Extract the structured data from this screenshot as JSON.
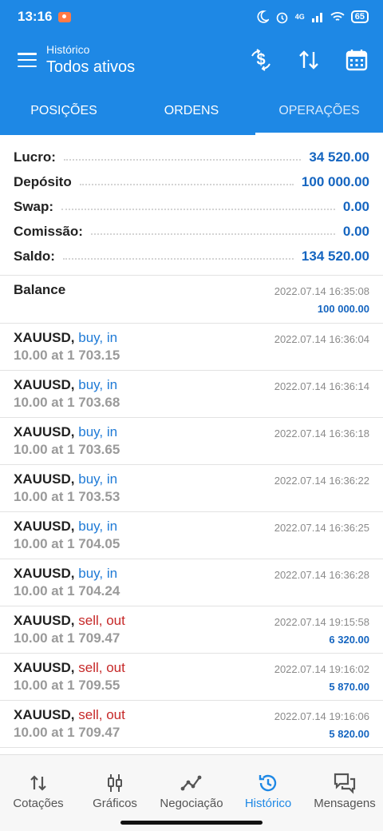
{
  "status_bar": {
    "time": "13:16",
    "battery": "65",
    "network": "4G"
  },
  "header": {
    "subtitle": "Histórico",
    "title": "Todos ativos"
  },
  "tabs": [
    {
      "label": "POSIÇÕES"
    },
    {
      "label": "ORDENS"
    },
    {
      "label": "OPERAÇÕES"
    }
  ],
  "summary": {
    "profit_label": "Lucro:",
    "profit_value": "34 520.00",
    "deposit_label": "Depósito",
    "deposit_value": "100 000.00",
    "swap_label": "Swap:",
    "swap_value": "0.00",
    "commission_label": "Comissão:",
    "commission_value": "0.00",
    "balance_label": "Saldo:",
    "balance_value": "134 520.00"
  },
  "balance_entry": {
    "label": "Balance",
    "time": "2022.07.14 16:35:08",
    "amount": "100 000.00"
  },
  "deals": [
    {
      "symbol": "XAUUSD,",
      "direction": "buy, in",
      "detail": "10.00 at 1 703.15",
      "time": "2022.07.14 16:36:04",
      "profit": ""
    },
    {
      "symbol": "XAUUSD,",
      "direction": "buy, in",
      "detail": "10.00 at 1 703.68",
      "time": "2022.07.14 16:36:14",
      "profit": ""
    },
    {
      "symbol": "XAUUSD,",
      "direction": "buy, in",
      "detail": "10.00 at 1 703.65",
      "time": "2022.07.14 16:36:18",
      "profit": ""
    },
    {
      "symbol": "XAUUSD,",
      "direction": "buy, in",
      "detail": "10.00 at 1 703.53",
      "time": "2022.07.14 16:36:22",
      "profit": ""
    },
    {
      "symbol": "XAUUSD,",
      "direction": "buy, in",
      "detail": "10.00 at 1 704.05",
      "time": "2022.07.14 16:36:25",
      "profit": ""
    },
    {
      "symbol": "XAUUSD,",
      "direction": "buy, in",
      "detail": "10.00 at 1 704.24",
      "time": "2022.07.14 16:36:28",
      "profit": ""
    },
    {
      "symbol": "XAUUSD,",
      "direction": "sell, out",
      "detail": "10.00 at 1 709.47",
      "time": "2022.07.14 19:15:58",
      "profit": "6 320.00"
    },
    {
      "symbol": "XAUUSD,",
      "direction": "sell, out",
      "detail": "10.00 at 1 709.55",
      "time": "2022.07.14 19:16:02",
      "profit": "5 870.00"
    },
    {
      "symbol": "XAUUSD,",
      "direction": "sell, out",
      "detail": "10.00 at 1 709.47",
      "time": "2022.07.14 19:16:06",
      "profit": "5 820.00"
    }
  ],
  "nav": [
    {
      "label": "Cotações",
      "icon": "quotes-icon"
    },
    {
      "label": "Gráficos",
      "icon": "candlestick-icon"
    },
    {
      "label": "Negociação",
      "icon": "trade-icon"
    },
    {
      "label": "Histórico",
      "icon": "history-icon"
    },
    {
      "label": "Mensagens",
      "icon": "messages-icon"
    }
  ],
  "colors": {
    "primary": "#1e88e5",
    "buy": "#1e7ad6",
    "sell": "#c62828",
    "value": "#1565c0"
  }
}
